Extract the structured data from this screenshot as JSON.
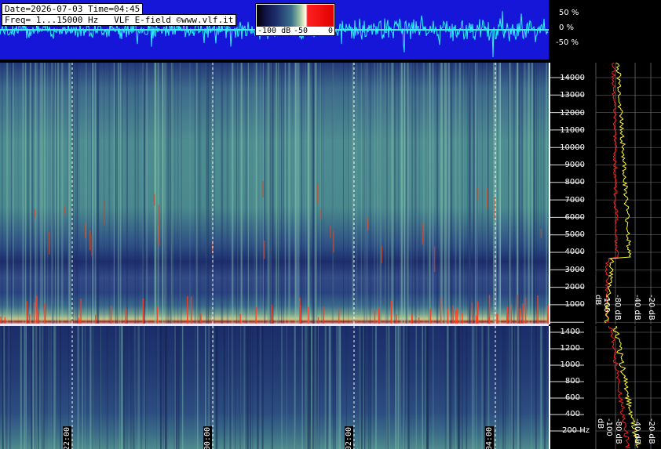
{
  "header": {
    "date_time": "Date=2026-07-03 Time=04:45",
    "freq_line": "Freq= 1...15000 Hz   VLF E-field ©www.vlf.it"
  },
  "scale": {
    "left": "-100 dB",
    "mid": "-50",
    "right": "0"
  },
  "amplitude_labels": [
    "50 %",
    "0 %",
    "-50 %"
  ],
  "hf_freq_labels": [
    "14000",
    "13000",
    "12000",
    "11000",
    "10000",
    "9000",
    "8000",
    "7000",
    "6000",
    "5000",
    "4000",
    "3000",
    "2000",
    "1000"
  ],
  "lf_freq_labels": [
    "1400",
    "1200",
    "1000",
    "800",
    "600",
    "400",
    "200 Hz"
  ],
  "time_labels": [
    "22:00",
    "00:00",
    "02:00",
    "04:00"
  ],
  "hf_db_labels": [
    "-100 dB",
    "-80 dB",
    "-40 dB",
    "-20 dB"
  ],
  "lf_db_labels": [
    "-100 dB",
    "-80 dB",
    "-40 dB",
    "-20 dB"
  ],
  "colors": {
    "strip_bg": "#1616d8",
    "waveform": "#30f0ff",
    "profile_red": "#ff2020",
    "profile_yellow": "#ffff30",
    "background": "#000000"
  }
}
